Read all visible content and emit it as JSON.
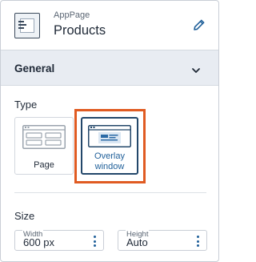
{
  "header": {
    "subtitle": "AppPage",
    "title": "Products",
    "edit_icon": "pencil-icon",
    "page_icon": "page-document-icon"
  },
  "section": {
    "title": "General",
    "toggle_icon": "chevron-down-icon"
  },
  "type": {
    "label": "Type",
    "options": [
      {
        "label": "Page",
        "selected": false,
        "icon": "page-layout-icon"
      },
      {
        "label": "Overlay\nwindow",
        "selected": true,
        "icon": "overlay-window-icon"
      }
    ]
  },
  "size": {
    "label": "Size",
    "width": {
      "label": "Width",
      "value": "600 px",
      "menu_icon": "kebab-menu-icon"
    },
    "height": {
      "label": "Height",
      "value": "Auto",
      "menu_icon": "kebab-menu-icon"
    }
  },
  "colors": {
    "accent": "#1f5f99",
    "selected_border": "#23476a",
    "highlight": "#e05b22",
    "section_bg": "#e8ecf2"
  }
}
